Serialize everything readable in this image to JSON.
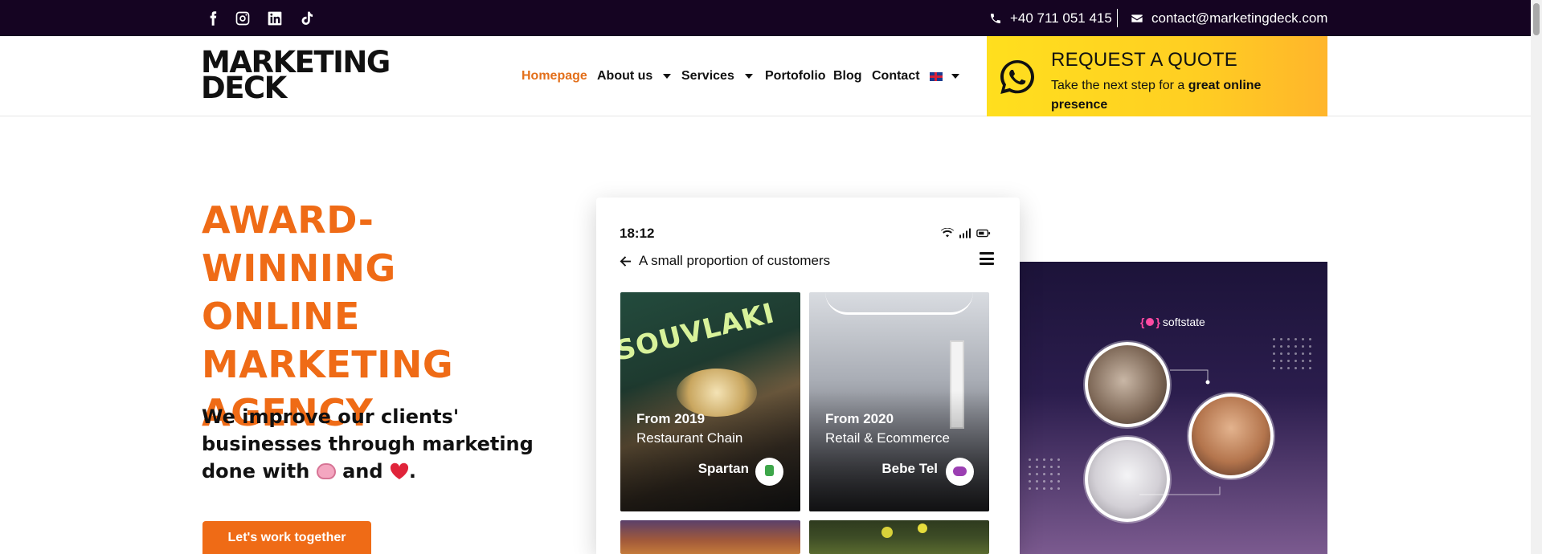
{
  "topbar": {
    "social_icons": [
      "facebook-icon",
      "instagram-icon",
      "linkedin-icon",
      "tiktok-icon"
    ],
    "phone": "+40 711 051 415",
    "email": "contact@marketingdeck.com"
  },
  "logo": {
    "line1": "MARKETING",
    "line2": "DECK"
  },
  "nav": {
    "items": [
      {
        "label": "Homepage",
        "active": true
      },
      {
        "label": "About us",
        "dropdown": true
      },
      {
        "label": "Services",
        "dropdown": true
      },
      {
        "label": "Portofolio"
      },
      {
        "label": "Blog"
      },
      {
        "label": "Contact"
      }
    ],
    "language_icon": "uk-flag-icon"
  },
  "quote": {
    "title": "REQUEST A QUOTE",
    "subtitle_plain": "Take the next step for a ",
    "subtitle_bold": "great online presence"
  },
  "hero": {
    "title_lines": [
      "AWARD-WINNING",
      "ONLINE",
      "MARKETING",
      "AGENCY"
    ],
    "subtitle_part1": "We improve our clients' businesses through marketing done with",
    "subtitle_and": "and",
    "subtitle_end": ".",
    "cta_label": "Let's work together"
  },
  "phone": {
    "time": "18:12",
    "back_label": "A small proportion of customers",
    "cards": [
      {
        "year": "From 2019",
        "sector": "Restaurant Chain",
        "name": "Spartan"
      },
      {
        "year": "From 2020",
        "sector": "Retail & Ecommerce",
        "name": "Bebe Tel"
      }
    ]
  },
  "softstate": {
    "logo_text": "softstate"
  },
  "colors": {
    "accent": "#ef6b16",
    "topbar": "#150422",
    "quote_yellow": "#ffd320"
  }
}
